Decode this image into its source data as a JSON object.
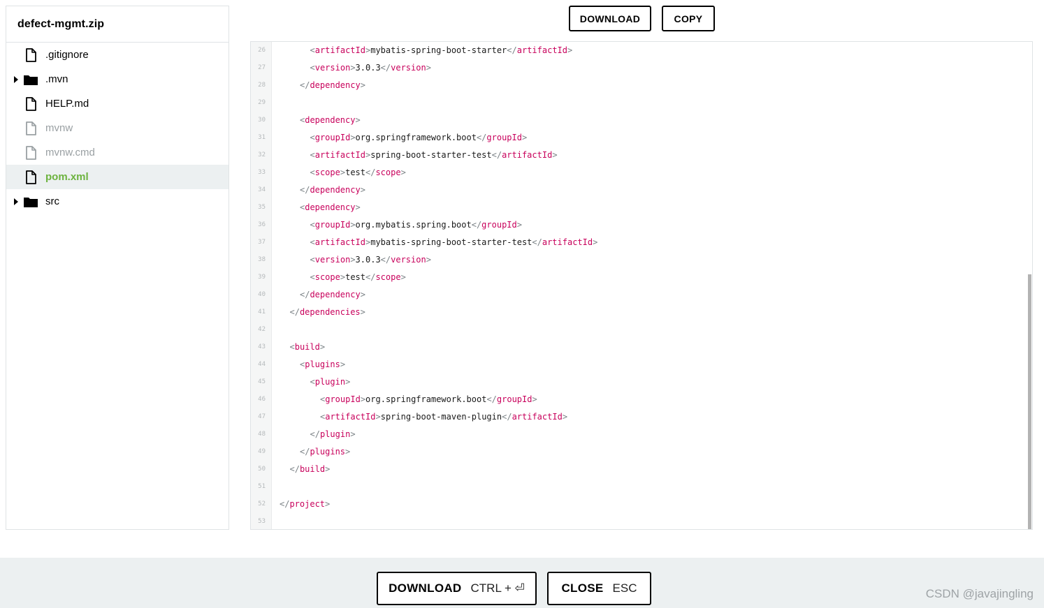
{
  "sidebar": {
    "title": "defect-mgmt.zip",
    "items": [
      {
        "label": ".gitignore",
        "type": "file",
        "dim": false,
        "selected": false
      },
      {
        "label": ".mvn",
        "type": "folder",
        "dim": false,
        "selected": false
      },
      {
        "label": "HELP.md",
        "type": "file",
        "dim": false,
        "selected": false
      },
      {
        "label": "mvnw",
        "type": "file",
        "dim": true,
        "selected": false
      },
      {
        "label": "mvnw.cmd",
        "type": "file",
        "dim": true,
        "selected": false
      },
      {
        "label": "pom.xml",
        "type": "file",
        "dim": false,
        "selected": true
      },
      {
        "label": "src",
        "type": "folder",
        "dim": false,
        "selected": false
      }
    ]
  },
  "toolbar": {
    "download_label": "DOWNLOAD",
    "copy_label": "COPY"
  },
  "code": {
    "lines": [
      {
        "n": "26",
        "indent": 3,
        "tag": "artifactId",
        "text": "mybatis-spring-boot-starter"
      },
      {
        "n": "27",
        "indent": 3,
        "tag": "version",
        "text": "3.0.3"
      },
      {
        "n": "28",
        "indent": 2,
        "close": "dependency"
      },
      {
        "n": "29",
        "indent": 0
      },
      {
        "n": "30",
        "indent": 2,
        "open": "dependency"
      },
      {
        "n": "31",
        "indent": 3,
        "tag": "groupId",
        "text": "org.springframework.boot"
      },
      {
        "n": "32",
        "indent": 3,
        "tag": "artifactId",
        "text": "spring-boot-starter-test"
      },
      {
        "n": "33",
        "indent": 3,
        "tag": "scope",
        "text": "test"
      },
      {
        "n": "34",
        "indent": 2,
        "close": "dependency"
      },
      {
        "n": "35",
        "indent": 2,
        "open": "dependency"
      },
      {
        "n": "36",
        "indent": 3,
        "tag": "groupId",
        "text": "org.mybatis.spring.boot"
      },
      {
        "n": "37",
        "indent": 3,
        "tag": "artifactId",
        "text": "mybatis-spring-boot-starter-test"
      },
      {
        "n": "38",
        "indent": 3,
        "tag": "version",
        "text": "3.0.3"
      },
      {
        "n": "39",
        "indent": 3,
        "tag": "scope",
        "text": "test"
      },
      {
        "n": "40",
        "indent": 2,
        "close": "dependency"
      },
      {
        "n": "41",
        "indent": 1,
        "close": "dependencies"
      },
      {
        "n": "42",
        "indent": 0
      },
      {
        "n": "43",
        "indent": 1,
        "open": "build"
      },
      {
        "n": "44",
        "indent": 2,
        "open": "plugins"
      },
      {
        "n": "45",
        "indent": 3,
        "open": "plugin"
      },
      {
        "n": "46",
        "indent": 4,
        "tag": "groupId",
        "text": "org.springframework.boot"
      },
      {
        "n": "47",
        "indent": 4,
        "tag": "artifactId",
        "text": "spring-boot-maven-plugin"
      },
      {
        "n": "48",
        "indent": 3,
        "close": "plugin"
      },
      {
        "n": "49",
        "indent": 2,
        "close": "plugins"
      },
      {
        "n": "50",
        "indent": 1,
        "close": "build"
      },
      {
        "n": "51",
        "indent": 0
      },
      {
        "n": "52",
        "indent": 0,
        "close": "project"
      },
      {
        "n": "53",
        "indent": 0
      }
    ]
  },
  "footer": {
    "download_label": "DOWNLOAD",
    "download_hint": "CTRL + ⏎",
    "close_label": "CLOSE",
    "close_hint": "ESC"
  },
  "watermark": "CSDN @javajingling",
  "colors": {
    "tag": "#c8005b",
    "selected_text": "#6db33f",
    "selected_bg": "#ecf0f1",
    "footer_bg": "#ecf0f1"
  }
}
